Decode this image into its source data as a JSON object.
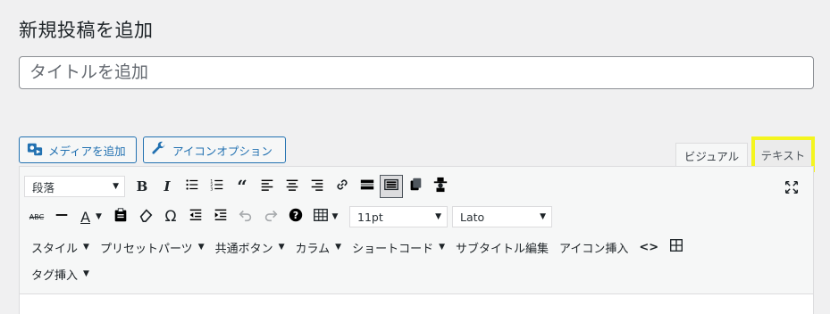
{
  "header": {
    "title": "新規投稿を追加"
  },
  "title_field": {
    "placeholder": "タイトルを追加"
  },
  "buttons": {
    "add_media": "メディアを追加",
    "icon_option": "アイコンオプション"
  },
  "tabs": {
    "visual": "ビジュアル",
    "text": "テキスト"
  },
  "toolbar": {
    "format_select": "段落",
    "font_size_select": "11pt",
    "font_family_select": "Lato",
    "strikethrough_label": "ABC",
    "text_color_label": "A",
    "omega_label": "Ω",
    "menus": [
      "スタイル",
      "プリセットパーツ",
      "共通ボタン",
      "カラム",
      "ショートコード"
    ],
    "plain_items": [
      "サブタイトル編集",
      "アイコン挿入"
    ],
    "code_label": "<>",
    "row4_menu": "タグ挿入",
    "highlight_color": "#f4f51f",
    "accent_color": "#2271b1"
  }
}
